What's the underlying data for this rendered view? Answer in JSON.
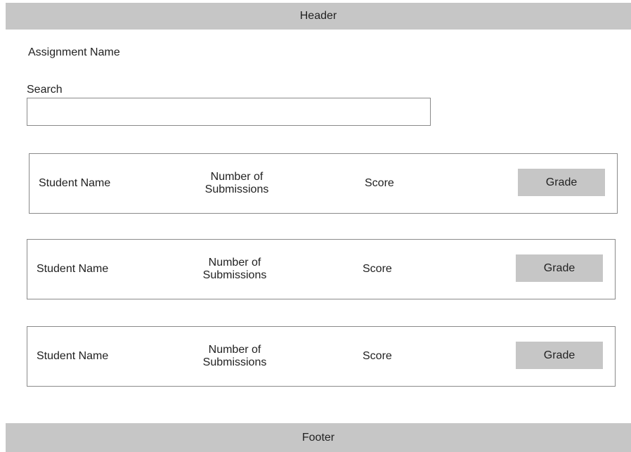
{
  "header": {
    "title": "Header"
  },
  "assignment": {
    "name": "Assignment Name"
  },
  "search": {
    "label": "Search",
    "value": "",
    "placeholder": ""
  },
  "rows": [
    {
      "student": "Student Name",
      "submissions": "Number of Submissions",
      "score": "Score",
      "action": "Grade"
    },
    {
      "student": "Student Name",
      "submissions": "Number of Submissions",
      "score": "Score",
      "action": "Grade"
    },
    {
      "student": "Student Name",
      "submissions": "Number of Submissions",
      "score": "Score",
      "action": "Grade"
    }
  ],
  "footer": {
    "title": "Footer"
  },
  "colors": {
    "bar_fill": "#c6c6c6",
    "border": "#8a8a8a",
    "text": "#222222"
  }
}
